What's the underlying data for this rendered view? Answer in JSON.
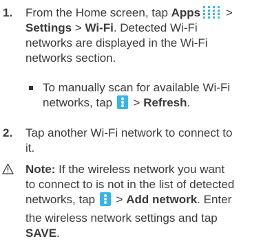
{
  "step1": {
    "number": "1.",
    "t1": "From the Home screen, tap ",
    "apps": "Apps",
    "gt1": " >",
    "settings": "Settings",
    "gt2": " > ",
    "wifi": "Wi-Fi",
    "t2": ". Detected Wi-Fi",
    "t3": "networks are displayed in the Wi-Fi",
    "t4": "networks section."
  },
  "bullet": {
    "t1": "To manually scan for available Wi-Fi",
    "t2": "networks, tap ",
    "gt": " > ",
    "refresh": "Refresh",
    "period": "."
  },
  "step2": {
    "number": "2.",
    "t1": "Tap another Wi-Fi network to connect to",
    "t2": "it."
  },
  "note": {
    "label": "Note:",
    "t1": " If the wireless network you want",
    "t2": "to connect to is not in the list of detected",
    "t3": "networks, tap ",
    "gt": " > ",
    "add_network": "Add network",
    "t4": ". Enter",
    "t5": "the wireless network settings and tap",
    "save": "SAVE",
    "period": "."
  },
  "colors": {
    "more_icon": "#35b6ea",
    "apps_icon": "#35b6ea"
  },
  "icons": [
    "apps-grid-icon",
    "more-options-icon",
    "warning-icon"
  ]
}
